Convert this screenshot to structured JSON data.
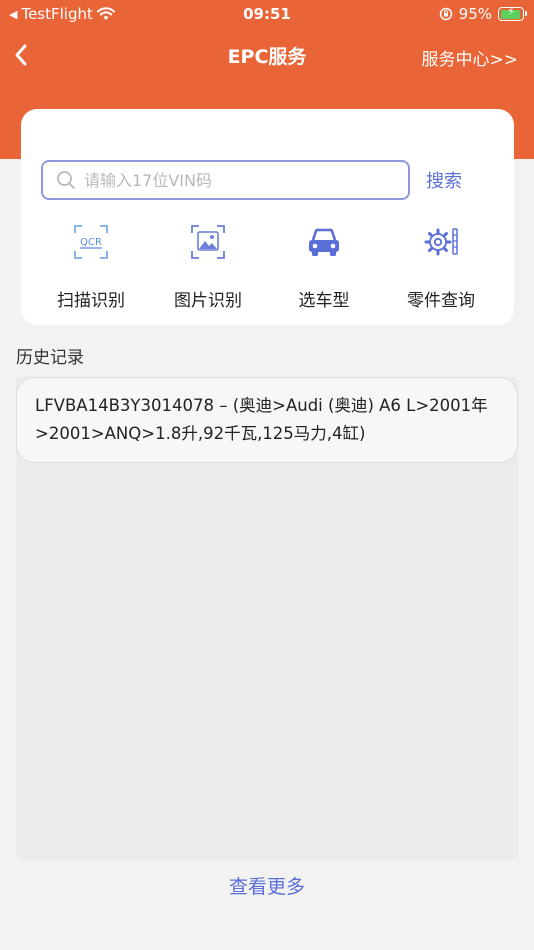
{
  "status_bar": {
    "carrier": "TestFlight",
    "time": "09:51",
    "battery": "95%",
    "battery_level": 0.95
  },
  "nav": {
    "title": "EPC服务",
    "service_center": "服务中心>>"
  },
  "search": {
    "placeholder": "请输入17位VIN码",
    "button_label": "搜索"
  },
  "functions": [
    {
      "label": "扫描识别",
      "icon": "qcr-scan-icon"
    },
    {
      "label": "图片识别",
      "icon": "image-recognition-icon"
    },
    {
      "label": "选车型",
      "icon": "car-icon"
    },
    {
      "label": "零件查询",
      "icon": "gear-parts-icon"
    }
  ],
  "history": {
    "title": "历史记录",
    "items": [
      {
        "text": "LFVBA14B3Y3014078 – (奥迪>Audi (奥迪) A6 L>2001年>2001>ANQ>1.8升,92千瓦,125马力,4缸)"
      }
    ],
    "more_label": "查看更多"
  },
  "colors": {
    "brand": "#e96436",
    "accent": "#5a6ed8"
  }
}
